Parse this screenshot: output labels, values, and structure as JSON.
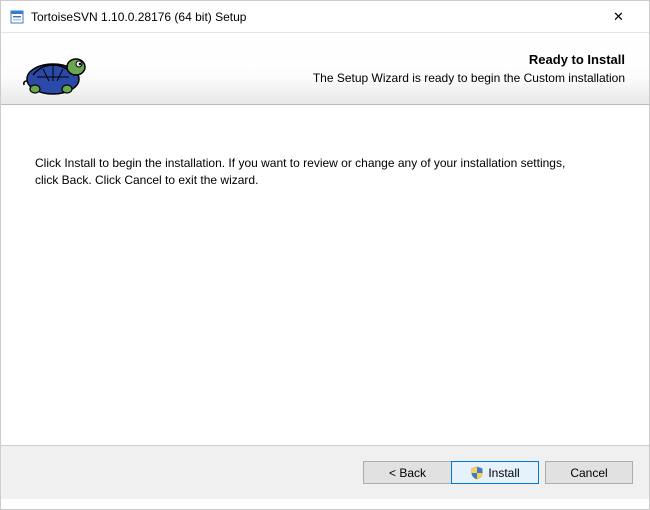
{
  "window": {
    "title": "TortoiseSVN 1.10.0.28176 (64 bit) Setup"
  },
  "header": {
    "title": "Ready to Install",
    "subtitle": "The Setup Wizard is ready to begin the Custom installation"
  },
  "body": {
    "text": "Click Install to begin the installation. If you want to review or change any of your installation settings, click Back. Click Cancel to exit the wizard."
  },
  "buttons": {
    "back": "< Back",
    "install": "Install",
    "cancel": "Cancel"
  },
  "icons": {
    "installer": "installer-icon",
    "close": "✕",
    "shield": "shield-icon",
    "logo": "tortoise-logo"
  }
}
